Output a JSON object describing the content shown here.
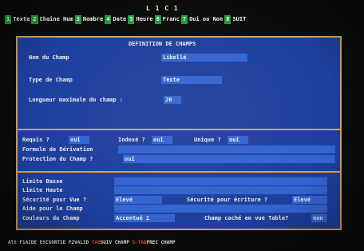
{
  "cursor_position": "L 1 C 1",
  "function_keys": [
    {
      "num": "1",
      "label": "Texte"
    },
    {
      "num": "2",
      "label": "Chaîne Num"
    },
    {
      "num": "3",
      "label": "Nombre"
    },
    {
      "num": "4",
      "label": "Date"
    },
    {
      "num": "5",
      "label": "Heure"
    },
    {
      "num": "6",
      "label": "Franc"
    },
    {
      "num": "7",
      "label": "Oui ou Non"
    },
    {
      "num": "8",
      "label": "SUIT"
    }
  ],
  "form": {
    "title": "DEFINITION DE CHAMPS",
    "field_name": {
      "label": "Nom du Champ",
      "value": "Libellé"
    },
    "field_type": {
      "label": "Type de Champ",
      "value": "Texte"
    },
    "max_length": {
      "label": "Longueur maximale du champ :",
      "value": "20"
    },
    "required": {
      "label": "Requis ?",
      "value": "oui"
    },
    "indexed": {
      "label": "Indexé ?",
      "value": "oui"
    },
    "unique": {
      "label": "Unique ?",
      "value": "oui"
    },
    "derivation": {
      "label": "Formule de Dérivation",
      "value": ""
    },
    "protection": {
      "label": "Protection du Champ ?",
      "value": "oui"
    },
    "low_limit": {
      "label": "Limite Basse",
      "value": ""
    },
    "high_limit": {
      "label": "Limite Haute",
      "value": ""
    },
    "view_security": {
      "label": "Sécurité pour Vue ?",
      "value": "Elevé"
    },
    "write_security": {
      "label": "Sécurité pour écriture ?",
      "value": "Elevé"
    },
    "help": {
      "label": "Aide pour le Champ",
      "value": ""
    },
    "colors": {
      "label": "Couleurs du Champ",
      "value": "Accentué 1"
    },
    "hidden": {
      "label": "Champ caché en vue Table?",
      "value": "non"
    }
  },
  "status_bar": [
    {
      "key": "Alt F1",
      "label": "AIDE"
    },
    {
      "key": "ESC",
      "label": "SORTIE"
    },
    {
      "key": "F2",
      "label": "VALID"
    },
    {
      "key": "TAB",
      "label": "SUIV CHAMP"
    },
    {
      "key": "S-TAB",
      "label": "PREC CHAMP"
    }
  ],
  "colors": {
    "panel": "#1d3f9e",
    "field": "#3364cf",
    "border": "#d6a24e",
    "fkey": "#1c9c3e"
  }
}
